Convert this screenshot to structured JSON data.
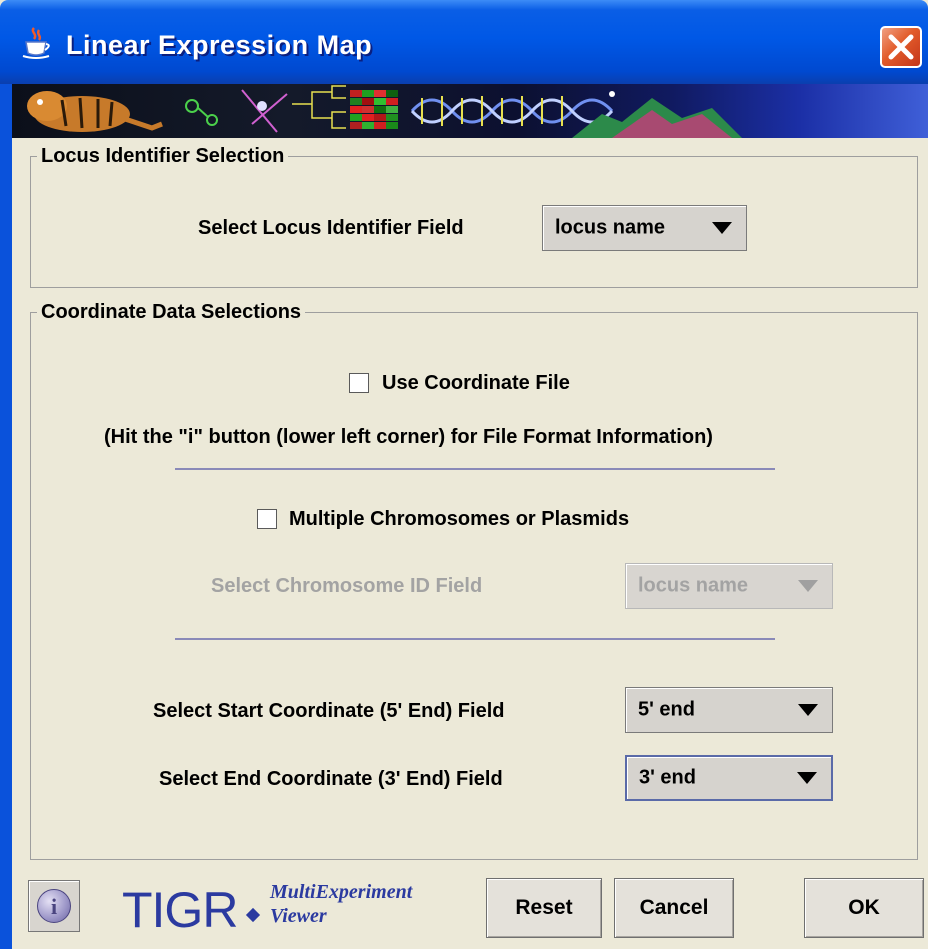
{
  "window": {
    "title": "Linear Expression Map"
  },
  "locus_panel": {
    "title": "Locus Identifier Selection",
    "field_label": "Select Locus Identifier Field",
    "field_value": "locus name"
  },
  "coord_panel": {
    "title": "Coordinate Data Selections",
    "use_coord_file_label": "Use Coordinate File",
    "use_coord_file_checked": false,
    "hint": "(Hit the \"i\" button (lower left corner) for File Format Information)",
    "multi_chrom_label": "Multiple Chromosomes or Plasmids",
    "multi_chrom_checked": false,
    "chrom_id_label": "Select Chromosome ID Field",
    "chrom_id_value": "locus name",
    "start_label": "Select Start Coordinate (5' End) Field",
    "start_value": "5' end",
    "end_label": "Select End Coordinate (3' End) Field",
    "end_value": "3' end"
  },
  "footer": {
    "logo_tigr": "TIGR",
    "logo_mev_line1": "MultiExperiment",
    "logo_mev_line2": "Viewer",
    "reset_label": "Reset",
    "cancel_label": "Cancel",
    "ok_label": "OK",
    "info_glyph": "i"
  },
  "colors": {
    "titlebar": "#0058e6",
    "dialog_bg": "#ece9d8",
    "logo_blue": "#2b3aa0",
    "separator": "#8a8ab8"
  },
  "icons": [
    "java-cup-icon",
    "close-icon",
    "info-icon",
    "dropdown-arrow-icon"
  ]
}
